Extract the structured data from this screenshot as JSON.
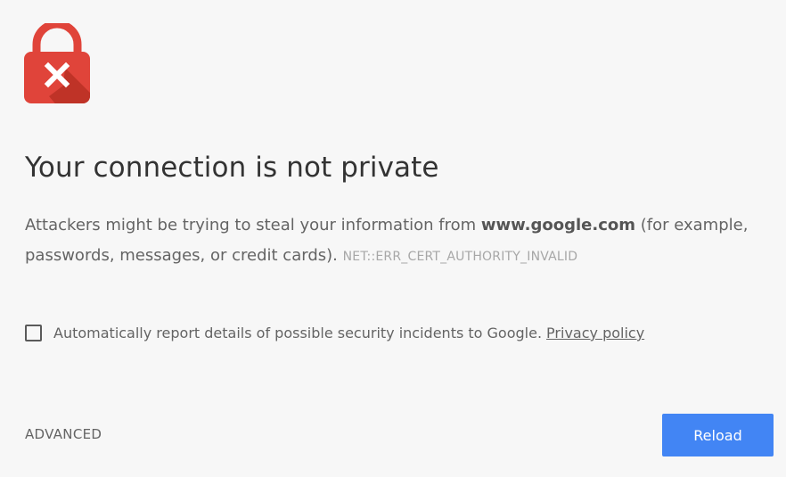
{
  "icon": {
    "name": "lock-error-icon",
    "colors": {
      "body": "#e0443a",
      "shadow": "#b83024",
      "mark": "#ffffff"
    }
  },
  "heading": {
    "title": "Your connection is not private"
  },
  "description": {
    "text_before": "Attackers might be trying to steal your information from ",
    "domain": "www.google.com",
    "text_after": " (for example, passwords, messages, or credit cards).",
    "error_code": "NET::ERR_CERT_AUTHORITY_INVALID"
  },
  "report": {
    "checked": false,
    "label": "Automatically report details of possible security incidents to Google.",
    "privacy_link": "Privacy policy"
  },
  "actions": {
    "advanced_label": "ADVANCED",
    "reload_label": "Reload"
  },
  "colors": {
    "background": "#f7f7f7",
    "primary_button": "#4285f4",
    "text": "#333333",
    "secondary_text": "#646464",
    "muted_text": "#a7a7a7"
  }
}
